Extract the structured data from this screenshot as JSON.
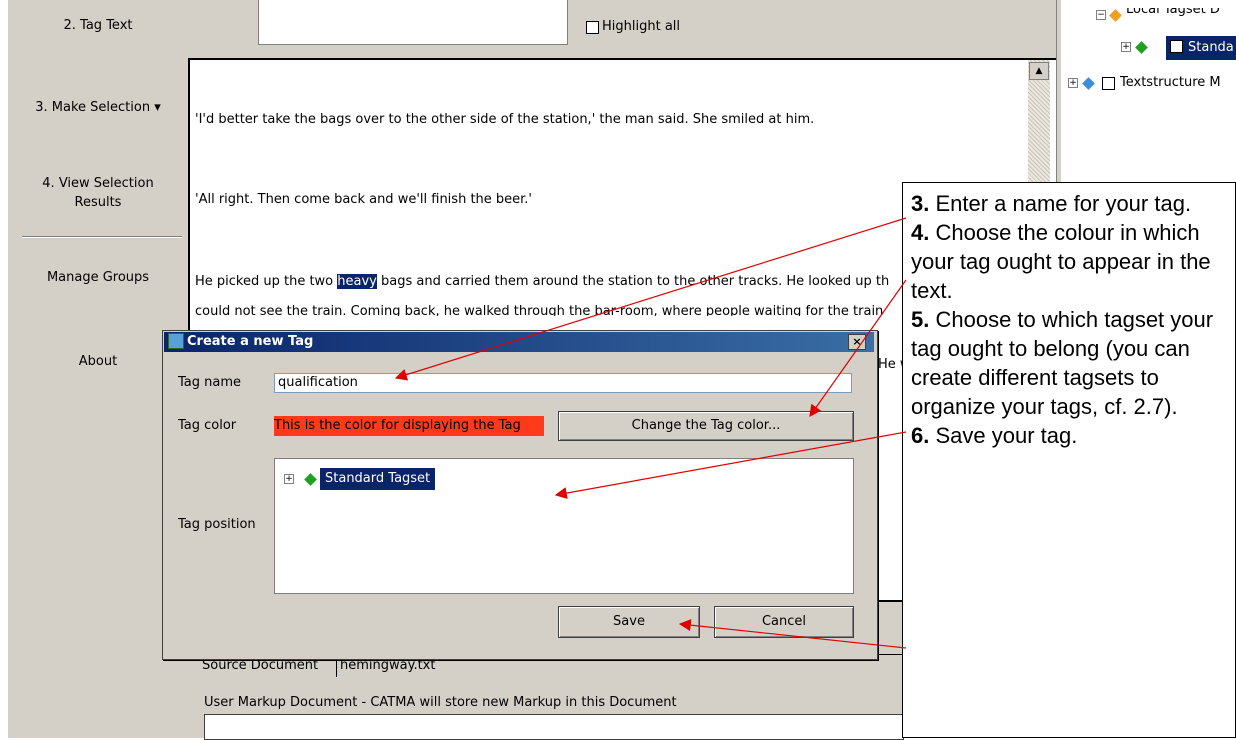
{
  "sidebar": {
    "items": [
      {
        "label": "2. Tag Text"
      },
      {
        "label": "3. Make Selection ▾"
      },
      {
        "label": "4. View Selection"
      },
      {
        "label": "Results"
      },
      {
        "label": "Manage Groups"
      },
      {
        "label": "About"
      }
    ]
  },
  "search": {
    "highlight_all_label": "Highlight all"
  },
  "text_panel": {
    "paragraphs": [
      "'I'd better take the bags over to the other side of the station,' the man said. She smiled at him.",
      "'All right. Then come back and we'll finish the beer.'",
      "He picked up the two ",
      "heavy",
      " bags and carried them around the station to the other tracks. He looked up th",
      "could not see the train. Coming back, he walked through the bar-room, where people waiting for the train",
      "He w"
    ]
  },
  "tree": {
    "item1": "Local Tagset D",
    "item2": "Standa",
    "item3": "Textstructure M"
  },
  "dialog": {
    "title": "Create a new Tag",
    "close_symbol": "×",
    "tag_name_label": "Tag name",
    "tag_name_value": "qualification",
    "tag_color_label": "Tag color",
    "tag_color_text": "This is the color for displaying the Tag",
    "tag_color_hex": "#ff3a1a",
    "change_color_button": "Change the Tag color...",
    "tag_position_label": "Tag position",
    "tree_item": "Standard Tagset",
    "save_button": "Save",
    "cancel_button": "Cancel"
  },
  "bottom": {
    "source_document_label": "Source Document",
    "source_document_value": "hemingway.txt",
    "user_markup_label": "User Markup Document - CATMA will store new Markup in this Document"
  },
  "callout": {
    "steps": [
      {
        "num": "3.",
        "text": " Enter a name for your tag."
      },
      {
        "num": "4.",
        "text": " Choose the colour in which your tag ought to appear in the text."
      },
      {
        "num": "5.",
        "text": " Choose to which tagset your tag ought to belong (you can create different tagsets to organize your tags, cf. 2.7)."
      },
      {
        "num": "6.",
        "text": " Save your tag."
      }
    ]
  },
  "colors": {
    "selection": "#0a246a",
    "arrow": "#e00000",
    "window": "#d4d0c8"
  }
}
